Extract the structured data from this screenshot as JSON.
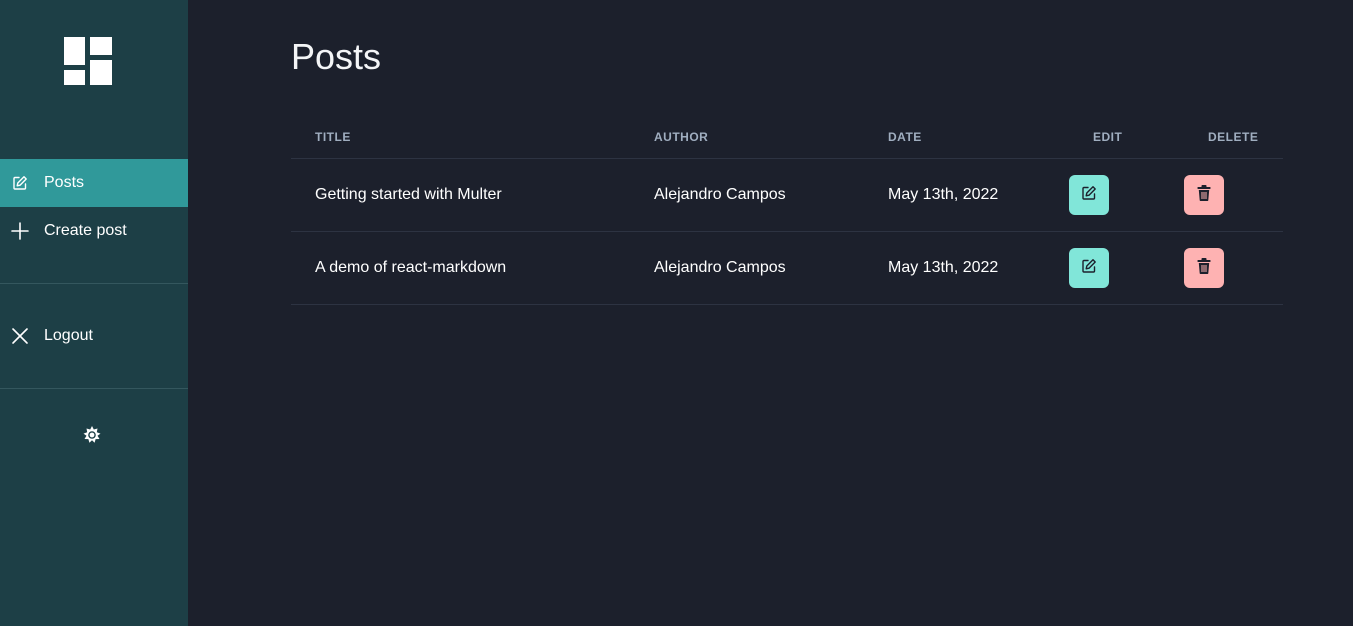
{
  "sidebar": {
    "logo_icon": "dashboard-logo-icon",
    "nav": [
      {
        "label": "Posts",
        "icon": "edit-icon",
        "active": true
      },
      {
        "label": "Create post",
        "icon": "plus-icon",
        "active": false
      }
    ],
    "logout": {
      "label": "Logout",
      "icon": "close-icon"
    },
    "theme_toggle_icon": "sun-icon"
  },
  "main": {
    "title": "Posts",
    "table": {
      "headers": [
        "TITLE",
        "AUTHOR",
        "DATE",
        "EDIT",
        "DELETE"
      ],
      "rows": [
        {
          "title": "Getting started with Multer",
          "author": "Alejandro Campos",
          "date": "May 13th, 2022"
        },
        {
          "title": "A demo of react-markdown",
          "author": "Alejandro Campos",
          "date": "May 13th, 2022"
        }
      ]
    }
  },
  "colors": {
    "sidebar_bg": "#1d3f46",
    "active_item": "#30999a",
    "main_bg": "#1c202c",
    "edit_button": "#81e6d9",
    "delete_button": "#feb2b2"
  }
}
